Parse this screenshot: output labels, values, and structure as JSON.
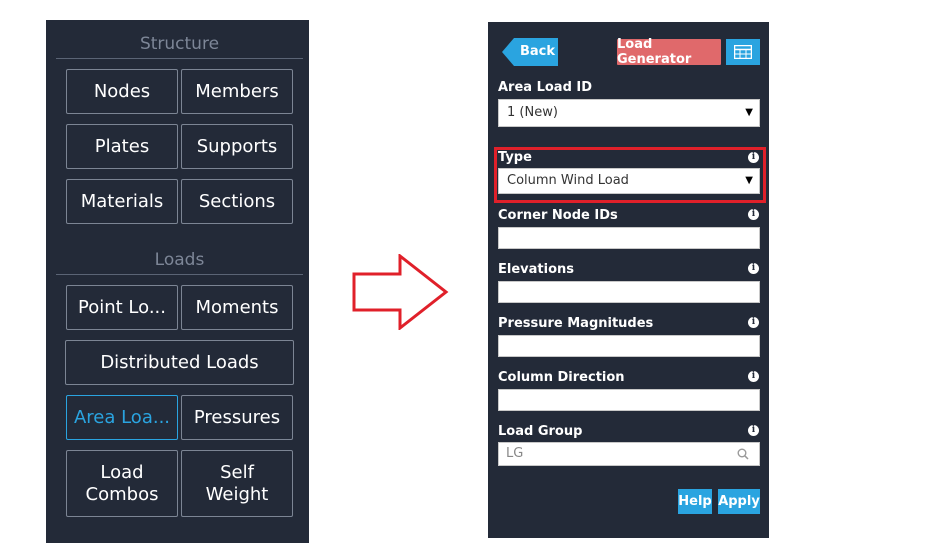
{
  "left_panel": {
    "structure_header": "Structure",
    "loads_header": "Loads",
    "buttons": {
      "nodes": "Nodes",
      "members": "Members",
      "plates": "Plates",
      "supports": "Supports",
      "materials": "Materials",
      "sections": "Sections",
      "point_loads": "Point Lo...",
      "moments": "Moments",
      "distributed_loads": "Distributed Loads",
      "area_loads": "Area Loa...",
      "pressures": "Pressures",
      "load_combos_line1": "Load",
      "load_combos_line2": "Combos",
      "self_weight_line1": "Self",
      "self_weight_line2": "Weight"
    },
    "active_button": "area_loads"
  },
  "arrow": {
    "icon": "right-arrow-outline-icon",
    "color": "#e0202a"
  },
  "right_panel": {
    "back_label": "Back",
    "load_generator_label": "Load Generator",
    "table_icon": "table-icon",
    "area_load_id": {
      "label": "Area Load ID",
      "value": "1 (New)"
    },
    "type": {
      "label": "Type",
      "value": "Column Wind Load"
    },
    "corner_node_ids": {
      "label": "Corner Node IDs",
      "value": ""
    },
    "elevations": {
      "label": "Elevations",
      "value": ""
    },
    "pressure_magnitudes": {
      "label": "Pressure Magnitudes",
      "value": ""
    },
    "column_direction": {
      "label": "Column Direction",
      "value": ""
    },
    "load_group": {
      "label": "Load Group",
      "value": "LG"
    },
    "help_label": "Help",
    "apply_label": "Apply",
    "info_glyph": "i"
  },
  "colors": {
    "panel_bg": "#232a38",
    "accent_blue": "#2aa4e0",
    "load_generator": "#e0696b",
    "highlight_red": "#e0202a"
  }
}
